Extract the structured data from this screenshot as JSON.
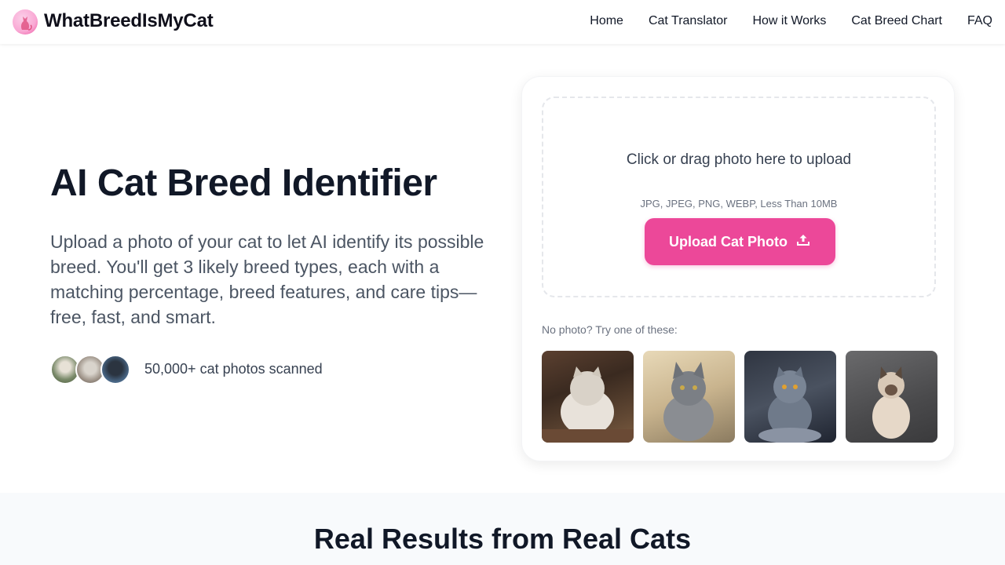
{
  "header": {
    "brand": "WhatBreedIsMyCat",
    "logo_icon": "cat-logo-icon",
    "nav": [
      "Home",
      "Cat Translator",
      "How it Works",
      "Cat Breed Chart",
      "FAQ"
    ]
  },
  "hero": {
    "title": "AI Cat Breed Identifier",
    "description": "Upload a photo of your cat to let AI identify its possible breed. You'll get 3 likely breed types, each with a matching percentage, breed features, and care tips—free, fast, and smart.",
    "scanned": "50,000+ cat photos scanned"
  },
  "upload": {
    "title": "Click or drag photo here to upload",
    "hint": "JPG, JPEG, PNG, WEBP, Less Than 10MB",
    "button": "Upload Cat Photo",
    "button_icon": "upload-icon",
    "sample_label": "No photo? Try one of these:"
  },
  "results": {
    "title": "Real Results from Real Cats"
  },
  "colors": {
    "accent": "#ec4899",
    "text": "#111827",
    "muted": "#4b5563"
  }
}
